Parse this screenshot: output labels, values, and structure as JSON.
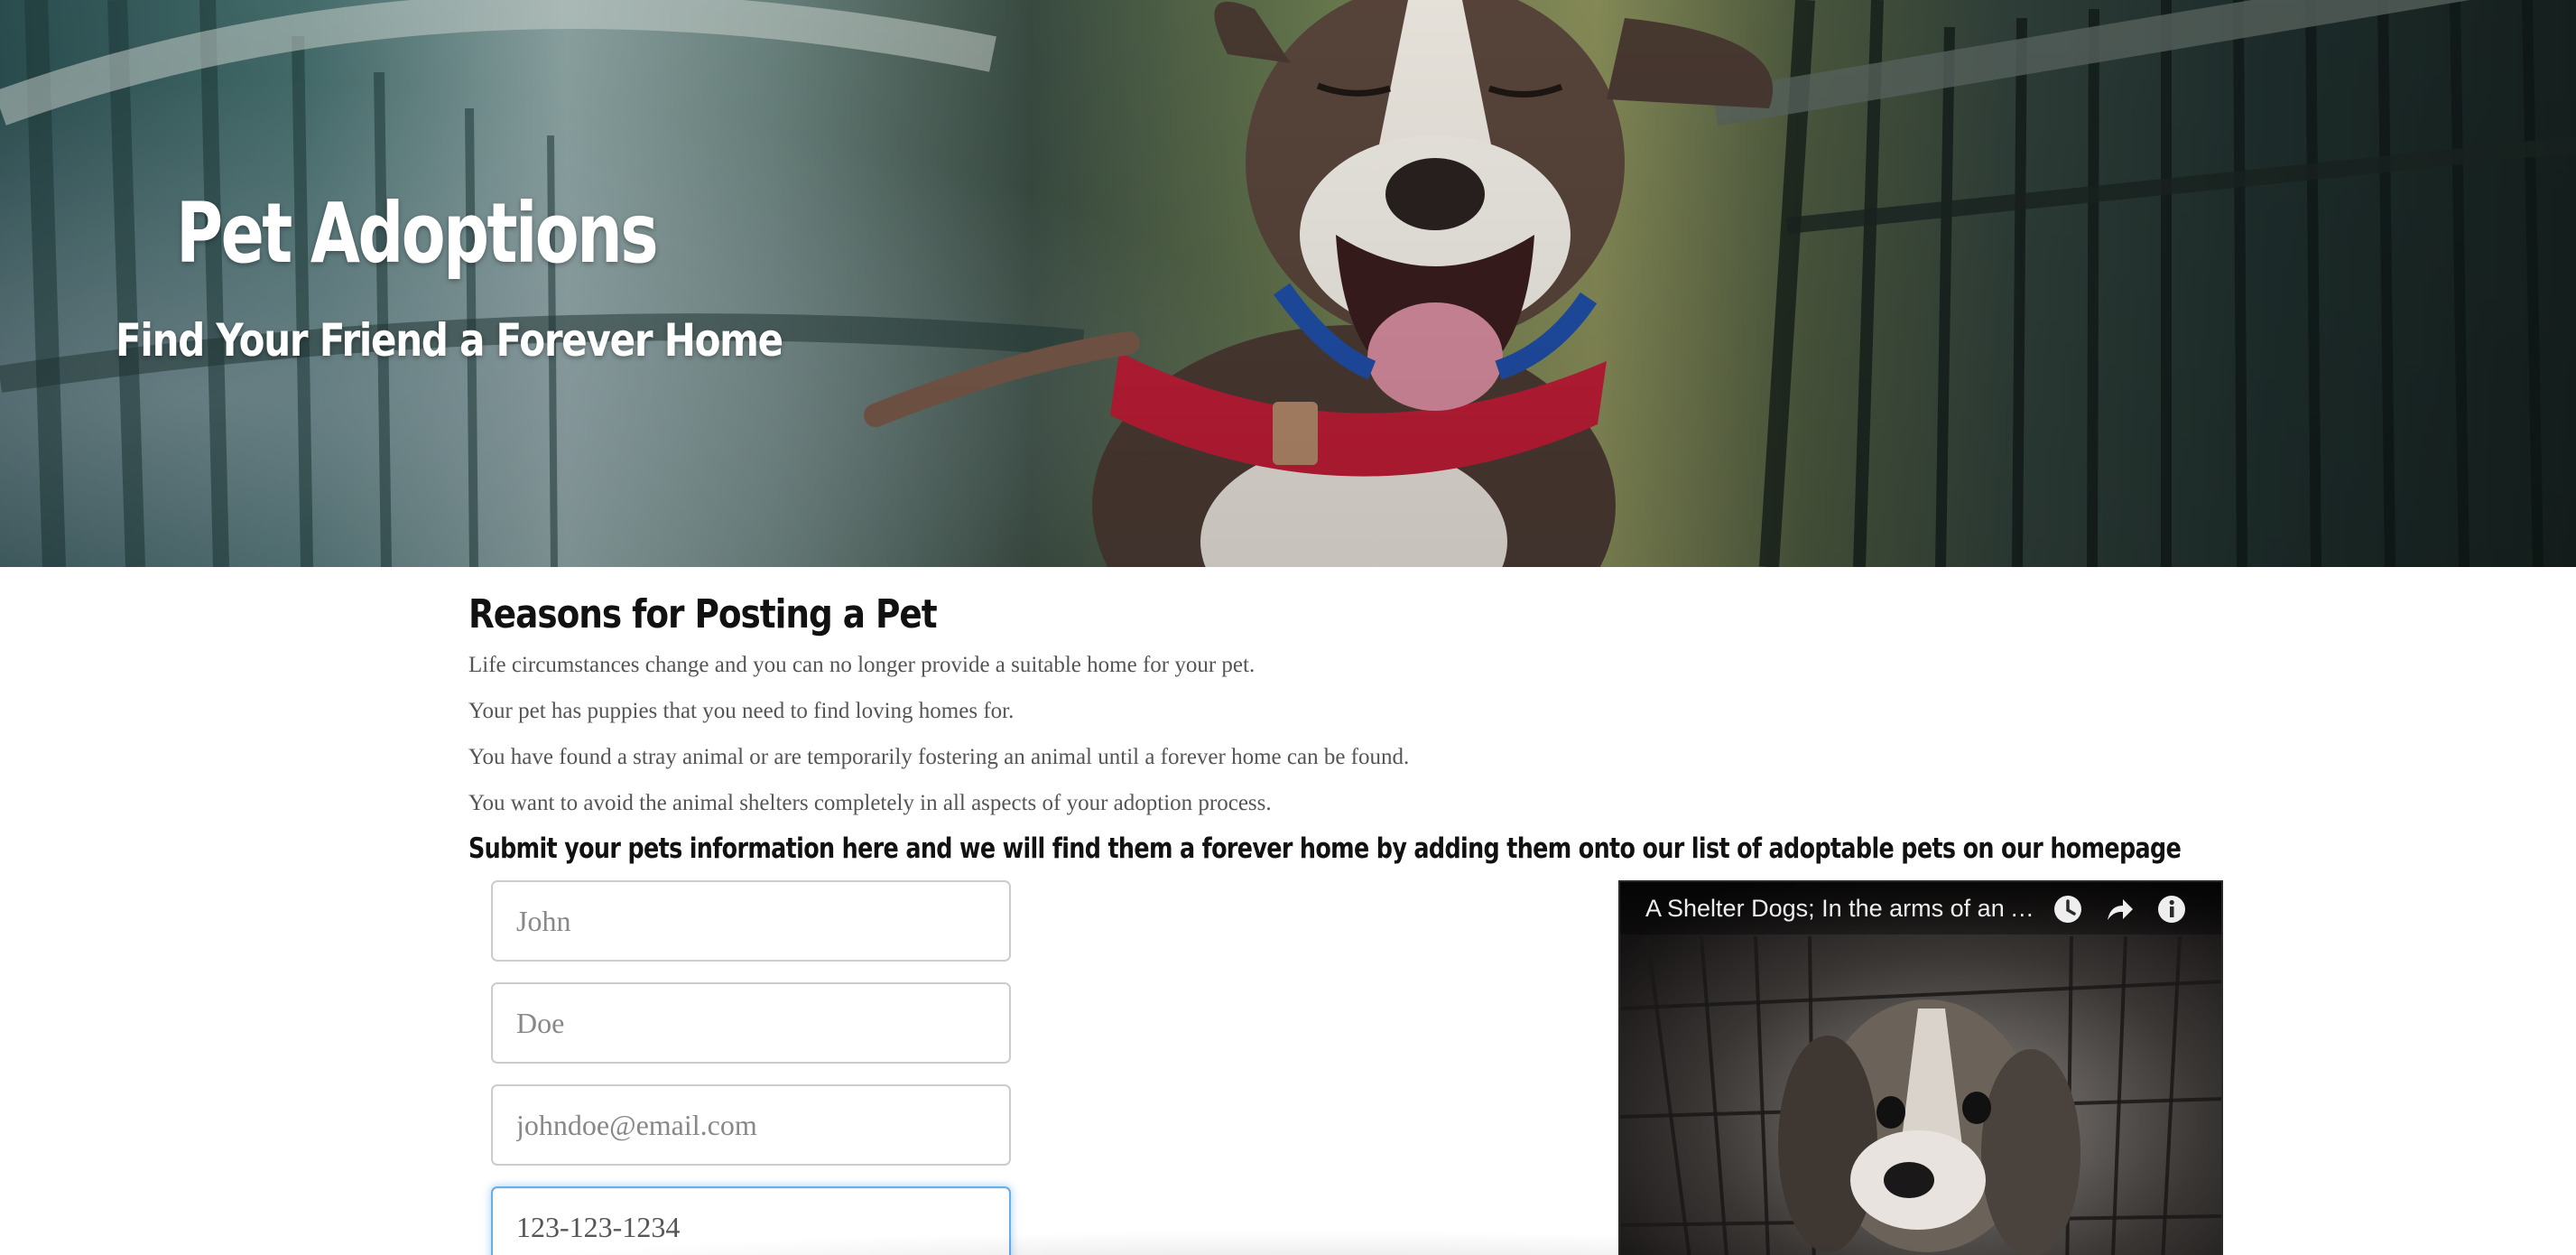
{
  "hero": {
    "title": "Pet Adoptions",
    "subtitle": "Find Your Friend a Forever Home"
  },
  "reasons": {
    "heading": "Reasons for Posting a Pet",
    "items": [
      "Life circumstances change and you can no longer provide a suitable home for your pet.",
      "Your pet has puppies that you need to find loving homes for.",
      "You have found a stray animal or are temporarily fostering an animal until a forever home can be found.",
      "You want to avoid the animal shelters completely in all aspects of your adoption process."
    ]
  },
  "form": {
    "intro": "Submit your pets information here and we will find them a forever home by adding them onto our list of adoptable pets on our homepage",
    "first_name": {
      "placeholder": "John",
      "value": ""
    },
    "last_name": {
      "placeholder": "Doe",
      "value": ""
    },
    "email": {
      "placeholder": "johndoe@email.com",
      "value": ""
    },
    "phone": {
      "placeholder": "",
      "value": "123-123-1234"
    }
  },
  "video": {
    "title": "A Shelter Dogs; In the arms of an Angel",
    "icons": [
      "clock-icon",
      "share-icon",
      "info-icon"
    ]
  },
  "colors": {
    "focus_border": "#66afe9",
    "heading_text": "#111111",
    "body_text": "#555555"
  }
}
